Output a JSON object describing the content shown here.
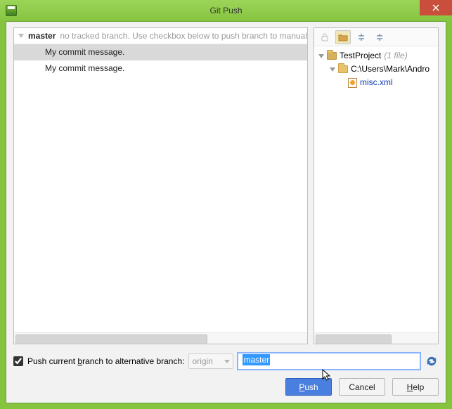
{
  "title": "Git Push",
  "titlebar": {
    "close_tooltip": "Close"
  },
  "left": {
    "branch": "master",
    "note": "no tracked branch. Use checkbox below to push branch to manually",
    "commits": [
      {
        "msg": "My commit message."
      },
      {
        "msg": "My commit message."
      }
    ]
  },
  "right": {
    "toolbar": {
      "lock": "lock-icon",
      "group_by_dir": "group-by-directory-icon",
      "expand_all": "expand-all-icon",
      "collapse_all": "collapse-all-icon"
    },
    "project_name": "TestProject",
    "project_suffix": "(1 file)",
    "folder_path": "C:\\Users\\Mark\\Andro",
    "file_name": "misc.xml"
  },
  "options": {
    "checkbox_label_pre": "Push current ",
    "checkbox_label_u": "b",
    "checkbox_label_post": "ranch to alternative branch:",
    "checked": true,
    "origin_label": "origin",
    "branch_input_value": "master"
  },
  "buttons": {
    "push_u": "P",
    "push_rest": "ush",
    "cancel": "Cancel",
    "help_u": "H",
    "help_rest": "elp"
  }
}
